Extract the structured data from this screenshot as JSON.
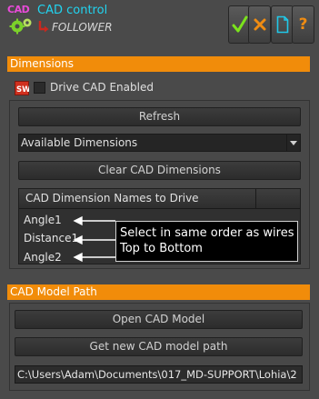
{
  "header": {
    "logo_text": "CAD",
    "title": "CAD control",
    "subtitle": "FOLLOWER"
  },
  "toolbar": {
    "ok_icon": "check-icon",
    "cancel_icon": "x-icon",
    "new_icon": "document-icon",
    "help_label": "?",
    "colors": {
      "ok": "#7be31c",
      "cancel": "#f08c12",
      "doc": "#20c8e8",
      "help": "#f08c12"
    }
  },
  "dimensions": {
    "section_title": "Dimensions",
    "drive_label": "Drive CAD Enabled",
    "drive_checked": false,
    "refresh_label": "Refresh",
    "available_dims": "Available Dimensions",
    "clear_label": "Clear CAD Dimensions",
    "table_header": "CAD Dimension Names to Drive",
    "rows": [
      "Angle1",
      "Distance1",
      "Angle2"
    ],
    "callout_line1": "Select in same order as wires",
    "callout_line2": "Top to Bottom"
  },
  "model_path": {
    "section_title": "CAD Model Path",
    "open_label": "Open CAD Model",
    "get_path_label": "Get new CAD model path",
    "path_value": "C:\\Users\\Adam\\Documents\\017_MD-SUPPORT\\Lohia\\2"
  },
  "colors": {
    "accent": "#f18c0a",
    "background": "#4a4a4a",
    "title": "#21d4f0"
  }
}
